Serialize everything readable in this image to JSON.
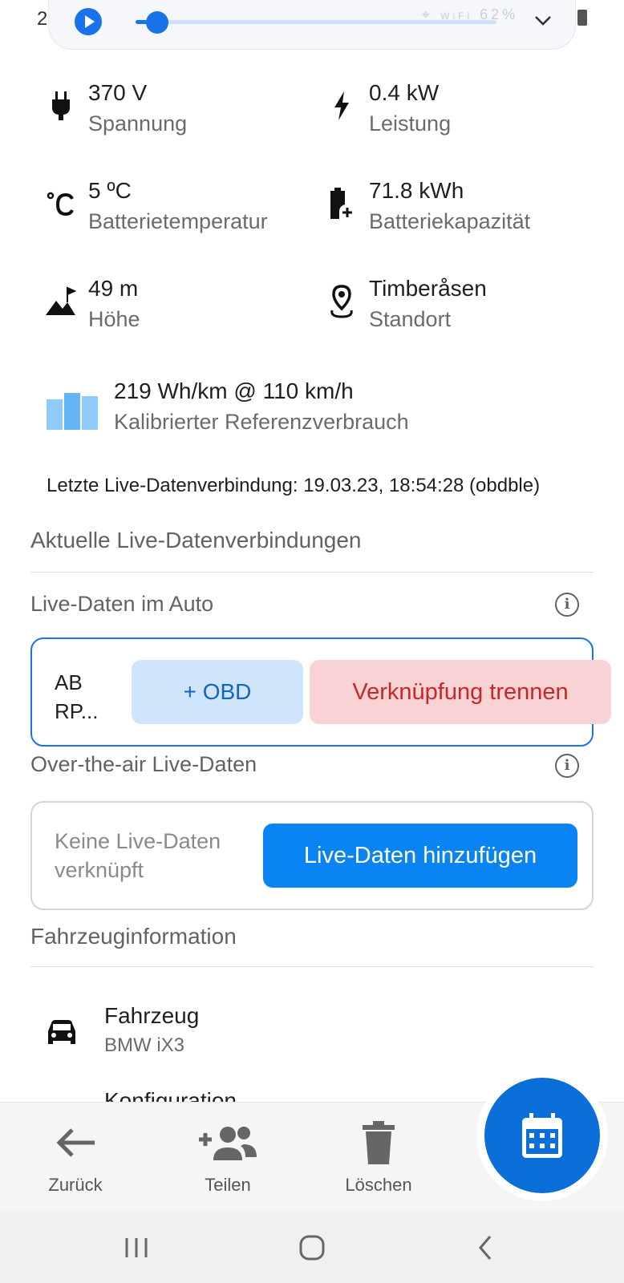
{
  "status_bar": {
    "time": "2",
    "wifi_label": "WiFi",
    "battery_percent": "62%"
  },
  "media": {
    "play_icon": "play-icon",
    "progress": 0.06
  },
  "stats": [
    {
      "value": "370 V",
      "label": "Spannung",
      "icon": "plug-icon"
    },
    {
      "value": "0.4 kW",
      "label": "Leistung",
      "icon": "bolt-icon"
    },
    {
      "value": "5 ºC",
      "label": "Batterietemperatur",
      "icon": "thermometer-celsius-icon"
    },
    {
      "value": "71.8 kWh",
      "label": "Batteriekapazität",
      "icon": "battery-plus-icon"
    },
    {
      "value": "49 m",
      "label": "Höhe",
      "icon": "mountain-flag-icon"
    },
    {
      "value": "Timberåsen",
      "label": "Standort",
      "icon": "location-pin-icon"
    }
  ],
  "reference": {
    "value": "219 Wh/km @ 110 km/h",
    "label": "Kalibrierter Referenzverbrauch",
    "icon": "bar-chart-icon"
  },
  "last_connection": "Letzte Live-Datenverbindung: 19.03.23, 18:54:28 (obdble)",
  "live_section": {
    "title": "Aktuelle Live-Datenverbindungen",
    "in_car": {
      "title": "Live-Daten im Auto",
      "device_name": "AB RP...",
      "obd_button": "+  OBD",
      "unlink_button": "Verknüpfung trennen"
    },
    "ota": {
      "title": "Over-the-air Live-Daten",
      "empty_text": "Keine Live-Daten verknüpft",
      "add_button": "Live-Daten hinzufügen"
    }
  },
  "vehicle_section": {
    "title": "Fahrzeuginformation",
    "vehicle_label": "Fahrzeug",
    "vehicle_value": "BMW iX3",
    "config_label": "Konfiguration"
  },
  "bottom_bar": {
    "back": "Zurück",
    "share": "Teilen",
    "delete": "Löschen"
  },
  "colors": {
    "accent": "#1a73e8",
    "primary_button": "#0b84f3",
    "danger_text": "#c62828",
    "danger_bg": "#f8d2d5",
    "obd_bg": "#cfe5fb"
  }
}
